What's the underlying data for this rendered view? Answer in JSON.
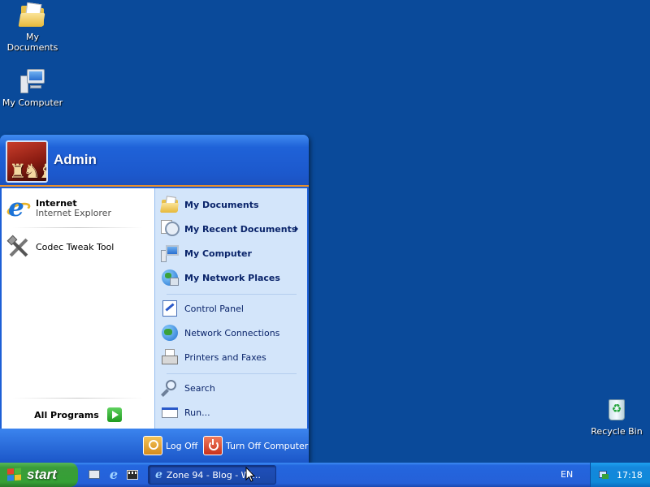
{
  "desktop": {
    "icons": [
      {
        "label": "My Documents",
        "icon": "folder-documents-icon"
      },
      {
        "label": "My Computer",
        "icon": "computer-icon"
      },
      {
        "label": "Recycle Bin",
        "icon": "recycle-bin-icon"
      }
    ]
  },
  "start_menu": {
    "user_name": "Admin",
    "pinned": [
      {
        "title": "Internet",
        "subtitle": "Internet Explorer",
        "icon": "internet-explorer-icon"
      }
    ],
    "recent": [
      {
        "title": "Codec Tweak Tool",
        "icon": "tools-icon"
      }
    ],
    "all_programs": "All Programs",
    "places": [
      {
        "label": "My Documents",
        "bold": true,
        "icon": "folder-icon"
      },
      {
        "label": "My Recent Documents",
        "bold": true,
        "icon": "recent-documents-icon",
        "submenu": true
      },
      {
        "label": "My Computer",
        "bold": true,
        "icon": "computer-icon"
      },
      {
        "label": "My Network Places",
        "bold": true,
        "icon": "network-places-icon"
      },
      {
        "label": "Control Panel",
        "bold": false,
        "icon": "control-panel-icon"
      },
      {
        "label": "Network Connections",
        "bold": false,
        "icon": "network-connections-icon"
      },
      {
        "label": "Printers and Faxes",
        "bold": false,
        "icon": "printer-icon"
      },
      {
        "label": "Search",
        "bold": false,
        "icon": "search-icon"
      },
      {
        "label": "Run...",
        "bold": false,
        "icon": "run-icon"
      }
    ],
    "footer": {
      "log_off": "Log Off",
      "turn_off": "Turn Off Computer"
    }
  },
  "taskbar": {
    "start_label": "start",
    "quick_launch": [
      "show-desktop-icon",
      "internet-explorer-icon",
      "media-player-icon"
    ],
    "task_button": "Zone 94 - Blog - Wi...",
    "language": "EN",
    "clock": "17:18"
  },
  "colors": {
    "desktop": "#0a4a9a",
    "start_green": "#3a9c3a",
    "taskbar_blue": "#2560d8",
    "accent_orange": "#e98f2c"
  }
}
